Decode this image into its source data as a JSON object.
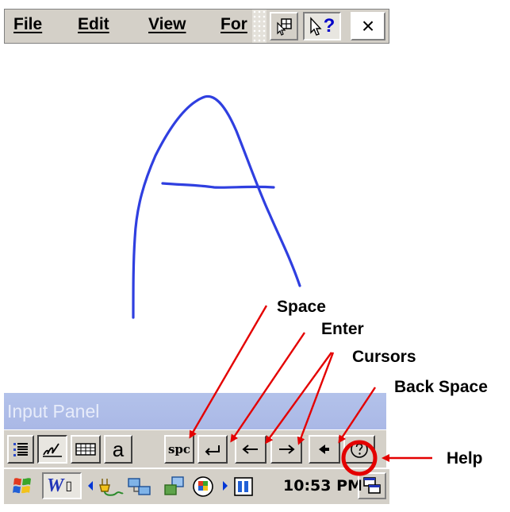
{
  "menubar": {
    "items": [
      {
        "label": "File"
      },
      {
        "label": "Edit"
      },
      {
        "label": "View"
      },
      {
        "label": "For"
      }
    ],
    "close_label": "×",
    "help_label": "?"
  },
  "input_panel": {
    "title": "Input Panel",
    "key_letter": "a",
    "key_space": "spc"
  },
  "taskbar": {
    "clock": "10:53 PM",
    "app_letter": "W"
  },
  "annotations": {
    "space": "Space",
    "enter": "Enter",
    "cursors": "Cursors",
    "back_space": "Back Space",
    "help": "Help"
  },
  "colors": {
    "stroke": "#2f3fe0",
    "arrow": "#e40000",
    "title_bar": "#aab8e6"
  },
  "icons": [
    "options-list-icon",
    "handwriting-icon",
    "keyboard-icon",
    "letter-a-key",
    "space-key",
    "enter-icon",
    "cursor-left-icon",
    "cursor-right-icon",
    "backspace-icon",
    "help-circle-icon",
    "whats-this-icon",
    "windows-flag-icon",
    "word-icon",
    "network-icon",
    "clock",
    "switch-windows-icon"
  ]
}
